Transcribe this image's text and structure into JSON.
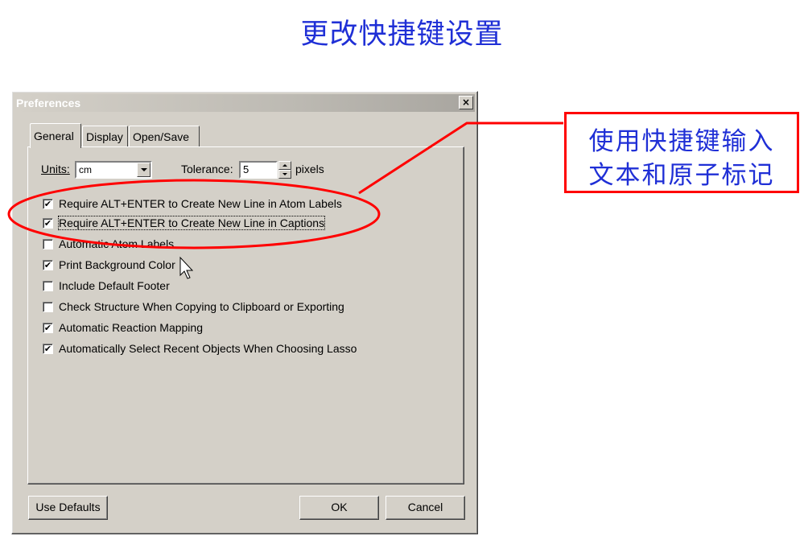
{
  "slide": {
    "title": "更改快捷键设置",
    "callout_lines": [
      "使用快捷键输入",
      "文本和原子标记"
    ]
  },
  "dialog": {
    "title": "Preferences",
    "close_glyph": "×",
    "tabs": [
      {
        "label": "General",
        "active": true
      },
      {
        "label": "Display",
        "active": false
      },
      {
        "label": "Open/Save",
        "active": false
      }
    ],
    "units": {
      "label": "Units:",
      "value": "cm"
    },
    "tolerance": {
      "label": "Tolerance:",
      "value": "5",
      "suffix": "pixels"
    },
    "checkboxes": [
      {
        "label": "Require ALT+ENTER to Create New Line in Atom Labels",
        "checked": true
      },
      {
        "label": "Require ALT+ENTER to Create New Line in Captions",
        "checked": true
      },
      {
        "label": "Automatic Atom Labels",
        "checked": false
      },
      {
        "label": "Print Background Color",
        "checked": true
      },
      {
        "label": "Include Default Footer",
        "checked": false
      },
      {
        "label": "Check Structure When Copying to Clipboard or Exporting",
        "checked": false
      },
      {
        "label": "Automatic Reaction Mapping",
        "checked": true
      },
      {
        "label": "Automatically Select Recent Objects When Choosing Lasso",
        "checked": true
      }
    ],
    "buttons": {
      "use_defaults": "Use Defaults",
      "ok": "OK",
      "cancel": "Cancel"
    }
  },
  "colors": {
    "highlight": "#ff0000",
    "text_blue": "#1f2fd6",
    "dialog_face": "#d4d0c8"
  },
  "icons": {
    "check": "check-icon",
    "cursor": "mouse-cursor-icon"
  }
}
